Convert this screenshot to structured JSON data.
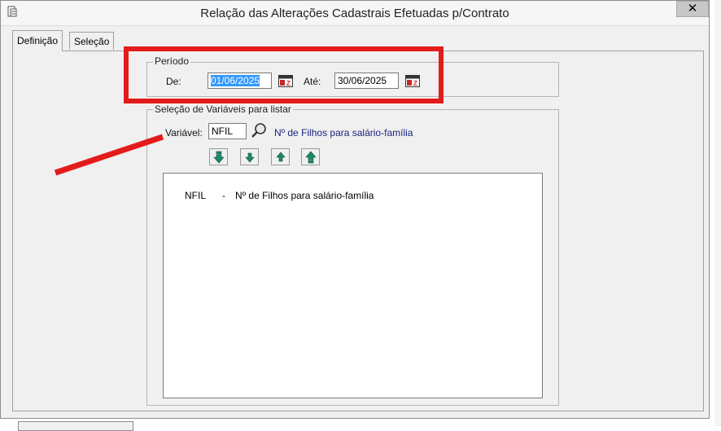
{
  "window": {
    "title": "Relação das Alterações Cadastrais Efetuadas p/Contrato",
    "close_label": "✕"
  },
  "tabs": [
    {
      "label": "Definição",
      "active": true
    },
    {
      "label": "Seleção",
      "active": false
    }
  ],
  "periodo": {
    "group_title": "Período",
    "de_label": "De:",
    "de_value": "01/06/2025",
    "ate_label": "Até:",
    "ate_value": "30/06/2025"
  },
  "selecao": {
    "group_title": "Seleção de Variáveis para listar",
    "variavel_label": "Variável:",
    "variavel_value": "NFIL",
    "variavel_description": "Nº de Filhos para salário-família",
    "list_items": [
      {
        "code": "NFIL",
        "separator": "-",
        "description": "Nº de Filhos para salário-família"
      }
    ]
  },
  "colors": {
    "annotation_red": "#e31b1b",
    "arrow_green": "#1a8a6a",
    "selection_blue": "#3399ff",
    "description_blue": "#1a237e"
  },
  "icons": {
    "calendar": "calendar-icon",
    "search": "magnifier-icon",
    "move_down_all": "double-arrow-down-icon",
    "move_down": "arrow-down-icon",
    "move_up": "arrow-up-icon",
    "move_up_all": "double-arrow-up-icon"
  }
}
